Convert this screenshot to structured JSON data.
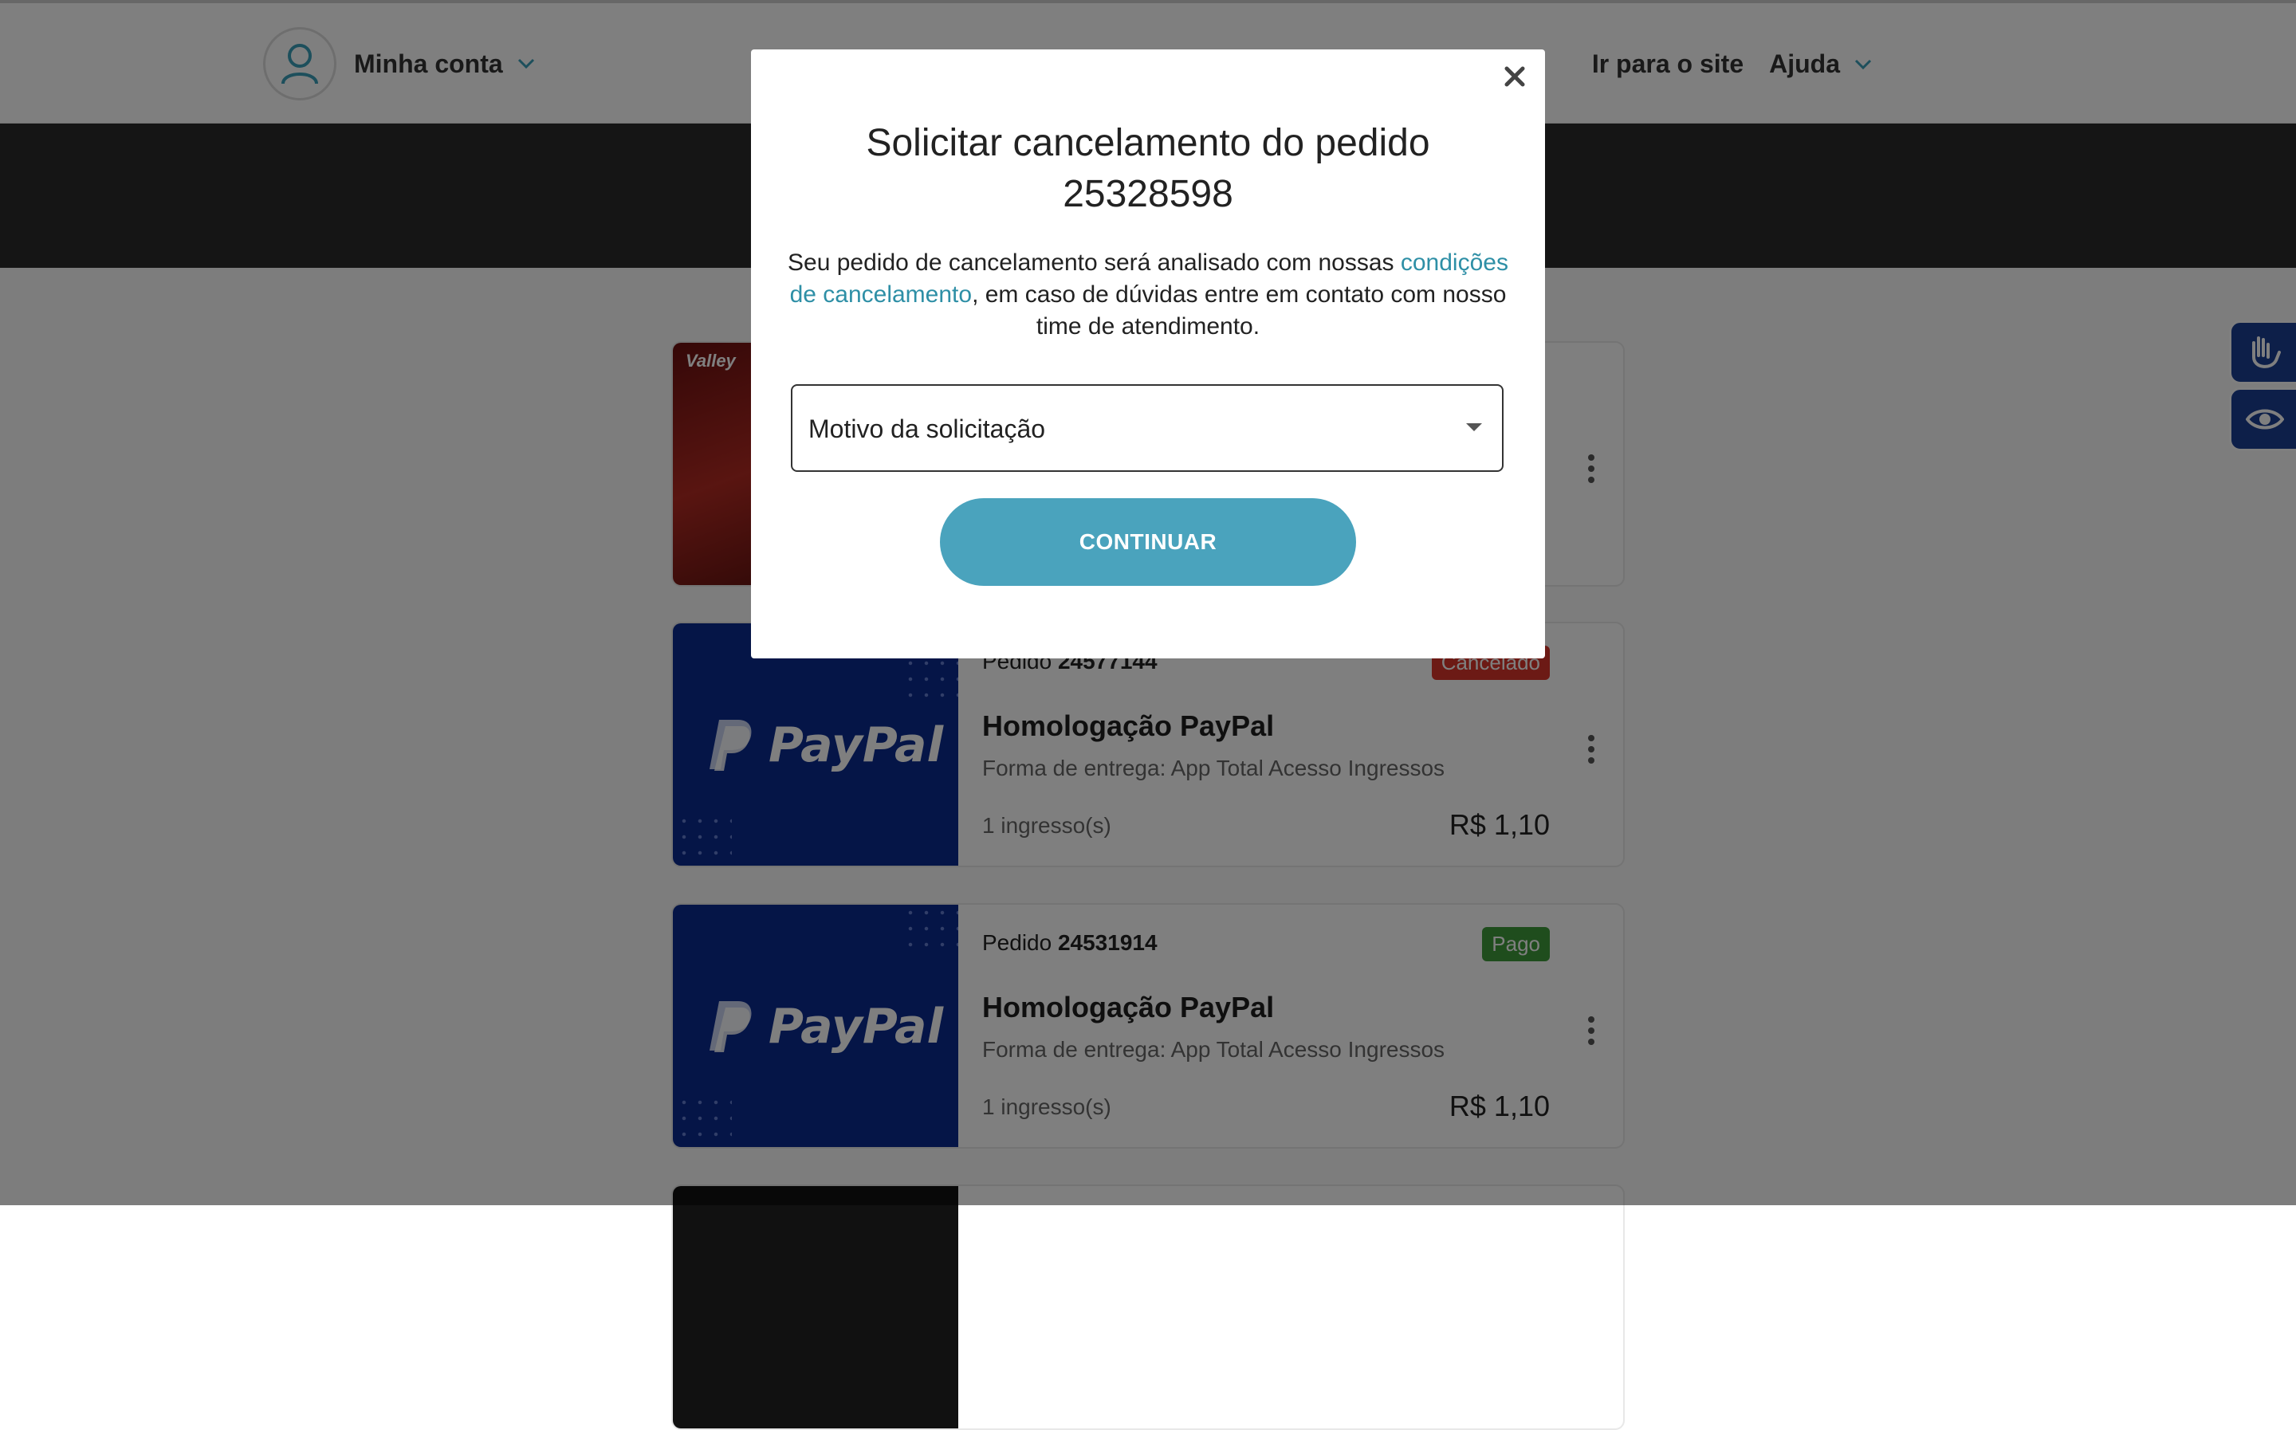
{
  "header": {
    "account_label": "Minha conta",
    "brand": "",
    "go_to_site": "Ir para o site",
    "help": "Ajuda"
  },
  "orders": [
    {
      "order_prefix": "Pedido",
      "order_number": "",
      "status": "",
      "title": "",
      "delivery": "",
      "quantity": "",
      "price": "",
      "thumb_text": "Valley"
    },
    {
      "order_prefix": "Pedido",
      "order_number": "24577144",
      "status": "Cancelado",
      "title": "Homologação PayPal",
      "delivery": "Forma de entrega: App Total Acesso Ingressos",
      "quantity": "1 ingresso(s)",
      "price": "R$ 1,10",
      "thumb_text": "PayPal"
    },
    {
      "order_prefix": "Pedido",
      "order_number": "24531914",
      "status": "Pago",
      "title": "Homologação PayPal",
      "delivery": "Forma de entrega: App Total Acesso Ingressos",
      "quantity": "1 ingresso(s)",
      "price": "R$ 1,10",
      "thumb_text": "PayPal"
    }
  ],
  "modal": {
    "title": "Solicitar cancelamento do pedido 25328598",
    "text_before": "Seu pedido de cancelamento será analisado com nossas ",
    "link_text": "condições de cancelamento",
    "text_after": ", em caso de dúvidas entre em contato com nosso time de atendimento.",
    "select_placeholder": "Motivo da solicitação",
    "continue_label": "CONTINUAR",
    "close_icon": "close-icon"
  },
  "colors": {
    "accent": "#4aa3bd",
    "link": "#2e8fa6",
    "cancel_badge": "#d9342b",
    "paid_badge": "#3f9a3b",
    "paypal_blue": "#0b2a8e",
    "a11y_blue": "#1b3f93"
  }
}
